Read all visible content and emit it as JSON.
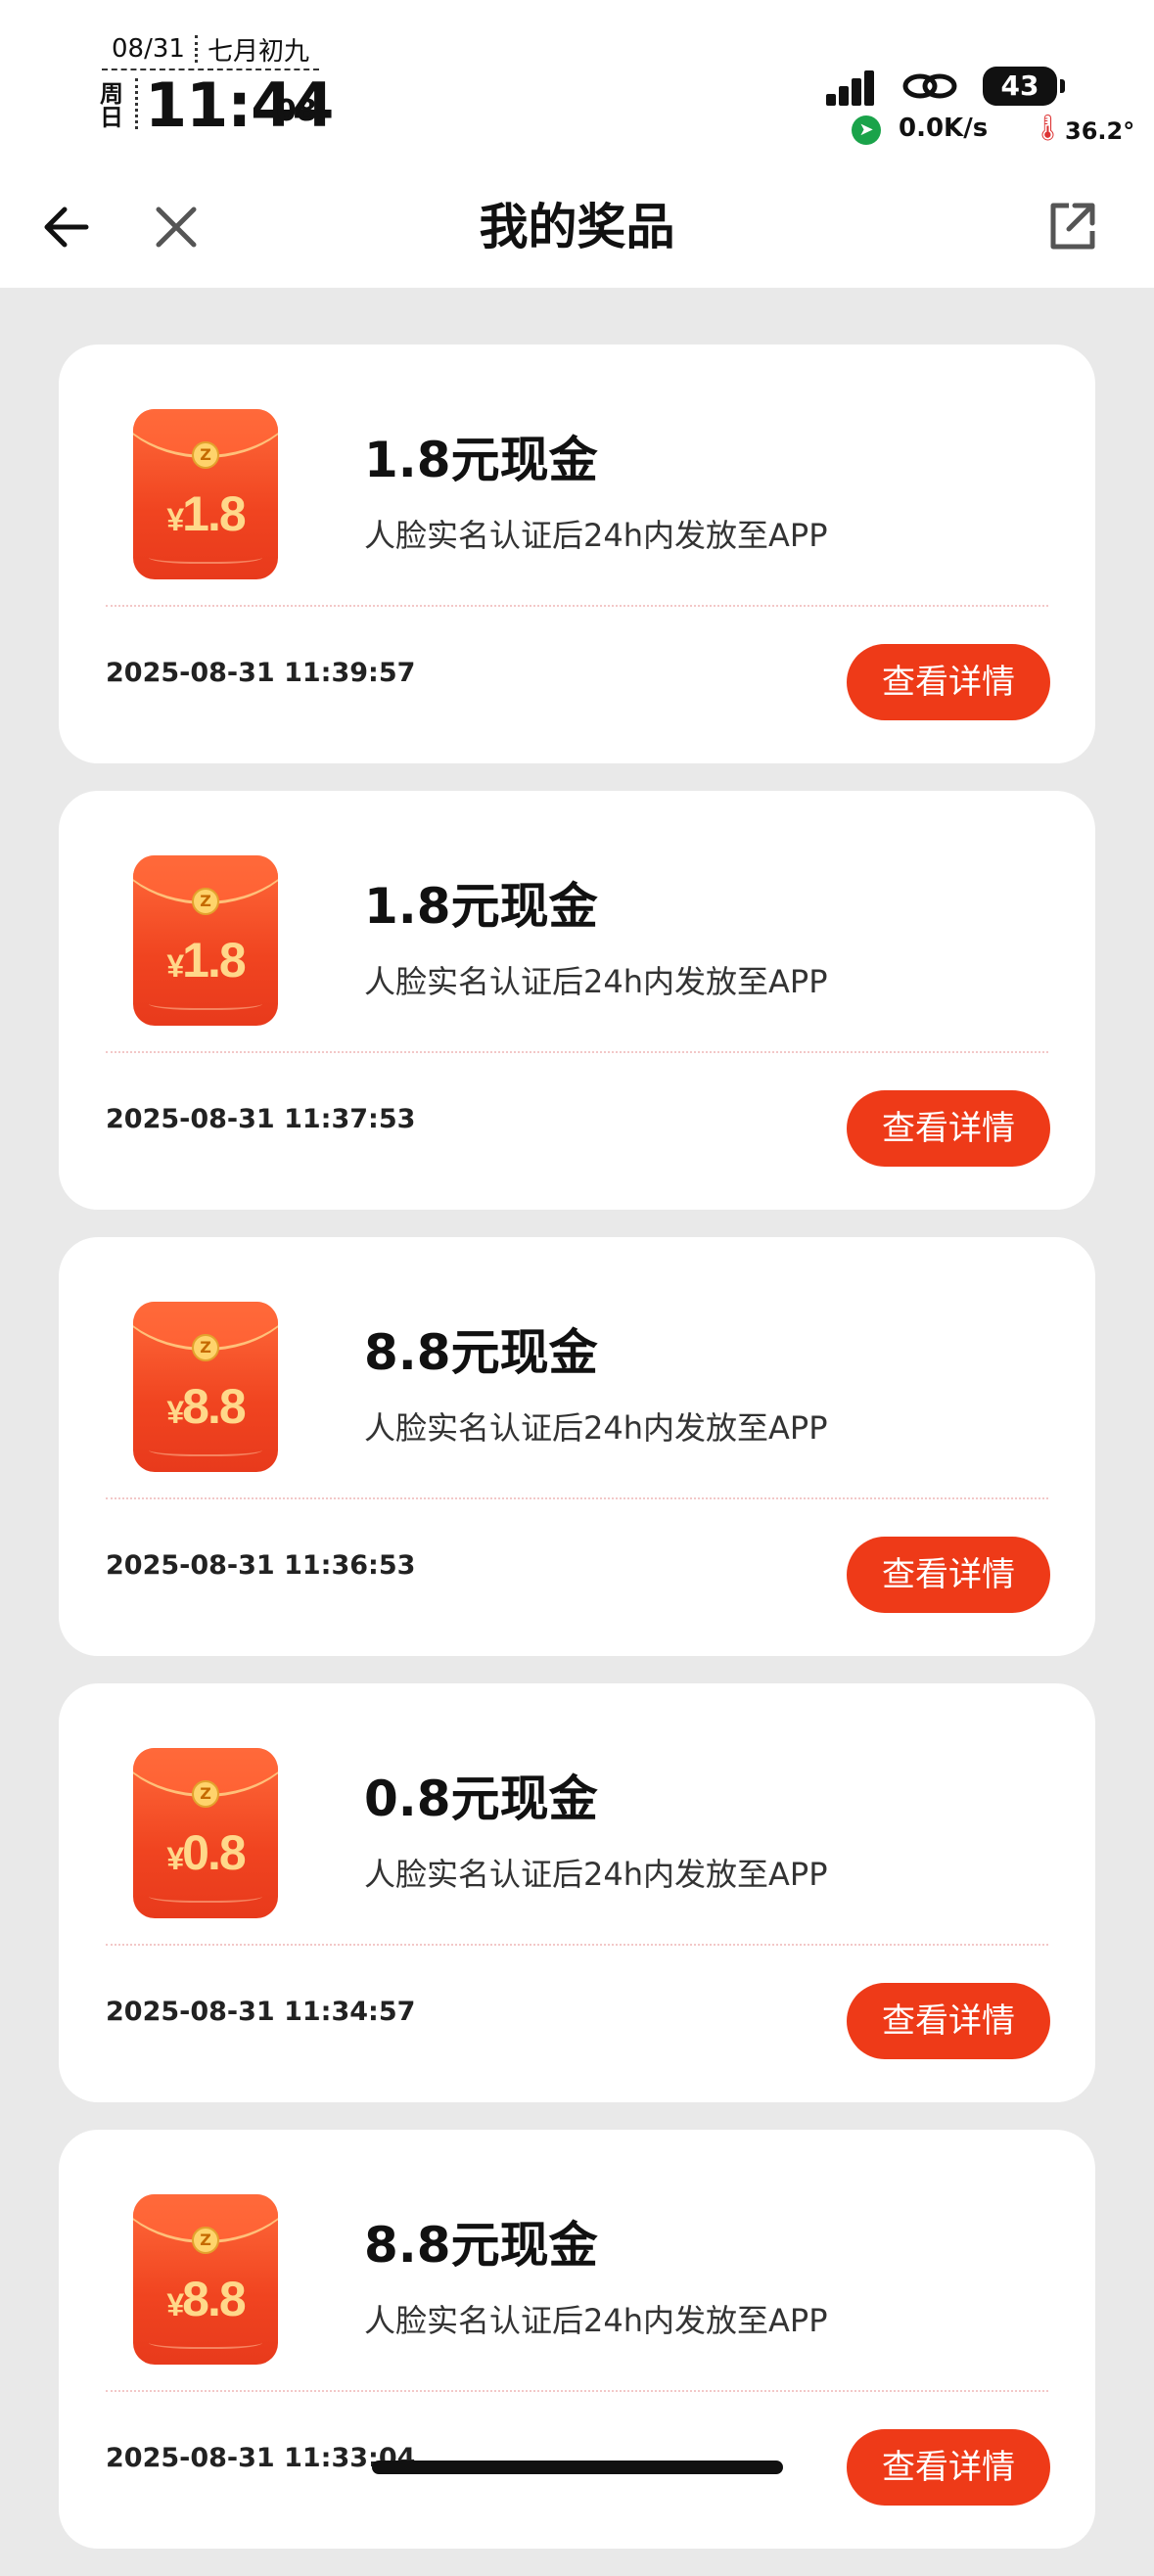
{
  "status_bar": {
    "date": "08/31",
    "lunar": "七月初九",
    "weekday": "周日",
    "time": "11:44",
    "seconds": "08",
    "battery": "43",
    "net_speed": "0.0K/s",
    "temperature": "36.2°"
  },
  "nav": {
    "title": "我的奖品"
  },
  "prizes": [
    {
      "amount": "1.8",
      "title": "1.8元现金",
      "desc": "人脸实名认证后24h内发放至APP",
      "time": "2025-08-31 11:39:57",
      "button": "查看详情"
    },
    {
      "amount": "1.8",
      "title": "1.8元现金",
      "desc": "人脸实名认证后24h内发放至APP",
      "time": "2025-08-31 11:37:53",
      "button": "查看详情"
    },
    {
      "amount": "8.8",
      "title": "8.8元现金",
      "desc": "人脸实名认证后24h内发放至APP",
      "time": "2025-08-31 11:36:53",
      "button": "查看详情"
    },
    {
      "amount": "0.8",
      "title": "0.8元现金",
      "desc": "人脸实名认证后24h内发放至APP",
      "time": "2025-08-31 11:34:57",
      "button": "查看详情"
    },
    {
      "amount": "8.8",
      "title": "8.8元现金",
      "desc": "人脸实名认证后24h内发放至APP",
      "time": "2025-08-31 11:33:04",
      "button": "查看详情"
    }
  ],
  "envelope": {
    "currency": "¥",
    "coin_letter": "Z"
  },
  "colors": {
    "accent": "#ee3a18",
    "page_bg": "#e9e9e9",
    "card_bg": "#ffffff"
  }
}
